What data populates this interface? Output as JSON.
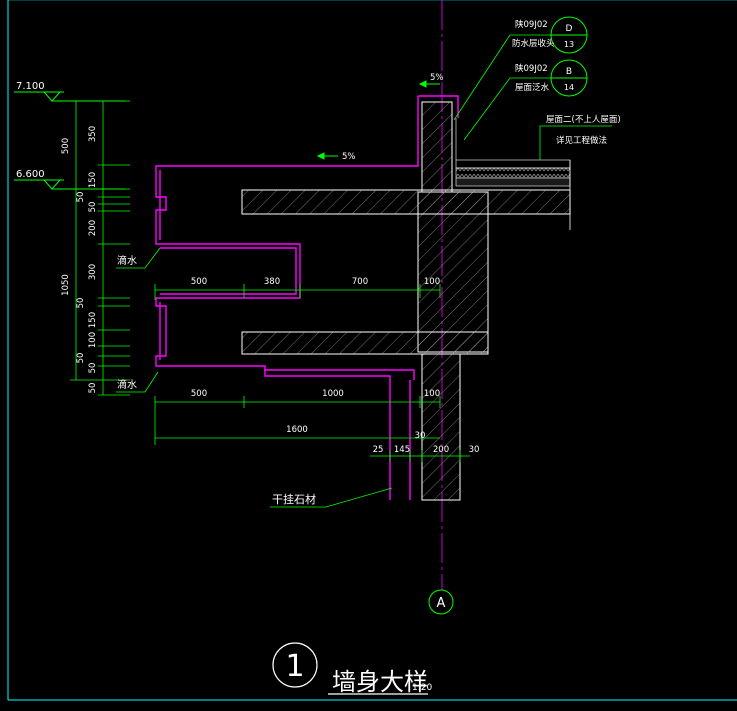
{
  "drawing": {
    "elevations": [
      "7.100",
      "6.600"
    ],
    "left_dims": [
      "500",
      "350",
      "150",
      "50",
      "50",
      "200",
      "1050",
      "300",
      "50",
      "150",
      "100",
      "50",
      "50",
      "50"
    ],
    "horiz_dims_upper": [
      "500",
      "380",
      "700",
      "100"
    ],
    "horiz_dims_lower": [
      "500",
      "1000",
      "100"
    ],
    "overall_dim": "1600",
    "bottom_dims": [
      "25",
      "145",
      "200",
      "30",
      "30"
    ],
    "slope": "5%",
    "drip_label": "滴水",
    "stone_label": "干挂石材",
    "callout_1": {
      "text1": "陕09J02",
      "text2": "防水层收头",
      "circle_top": "D",
      "circle_bottom": "13"
    },
    "callout_2": {
      "text1": "陕09J02",
      "text2": "屋面泛水",
      "circle_top": "B",
      "circle_bottom": "14"
    },
    "roof_note_1": "屋面二(不上人屋面)",
    "roof_note_2": "详见工程做法",
    "axis_label": "A",
    "title_number": "1",
    "title_text": "墙身大样",
    "scale": "1:20"
  },
  "colors": {
    "magenta": "#ff00ff",
    "green": "#00ff00",
    "cyan": "#00ffff",
    "white": "#ffffff",
    "grey": "#bfbfbf"
  }
}
